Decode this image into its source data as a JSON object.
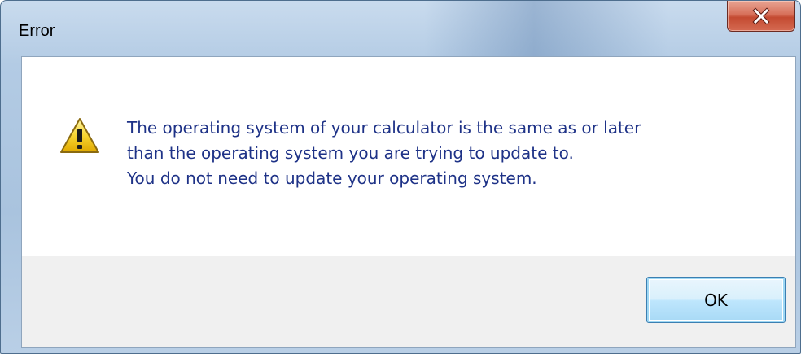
{
  "window": {
    "title": "Error"
  },
  "message": {
    "lines": [
      "The operating system of your calculator is the same as or later",
      "than the operating system you are trying to update to.",
      "You do not need to update your operating system."
    ]
  },
  "buttons": {
    "ok_label": "OK"
  },
  "icons": {
    "close": "close-icon",
    "warning": "warning-icon"
  },
  "colors": {
    "message_text": "#1e3287",
    "close_button": "#c44a31",
    "ok_button": "#bee6fd"
  }
}
